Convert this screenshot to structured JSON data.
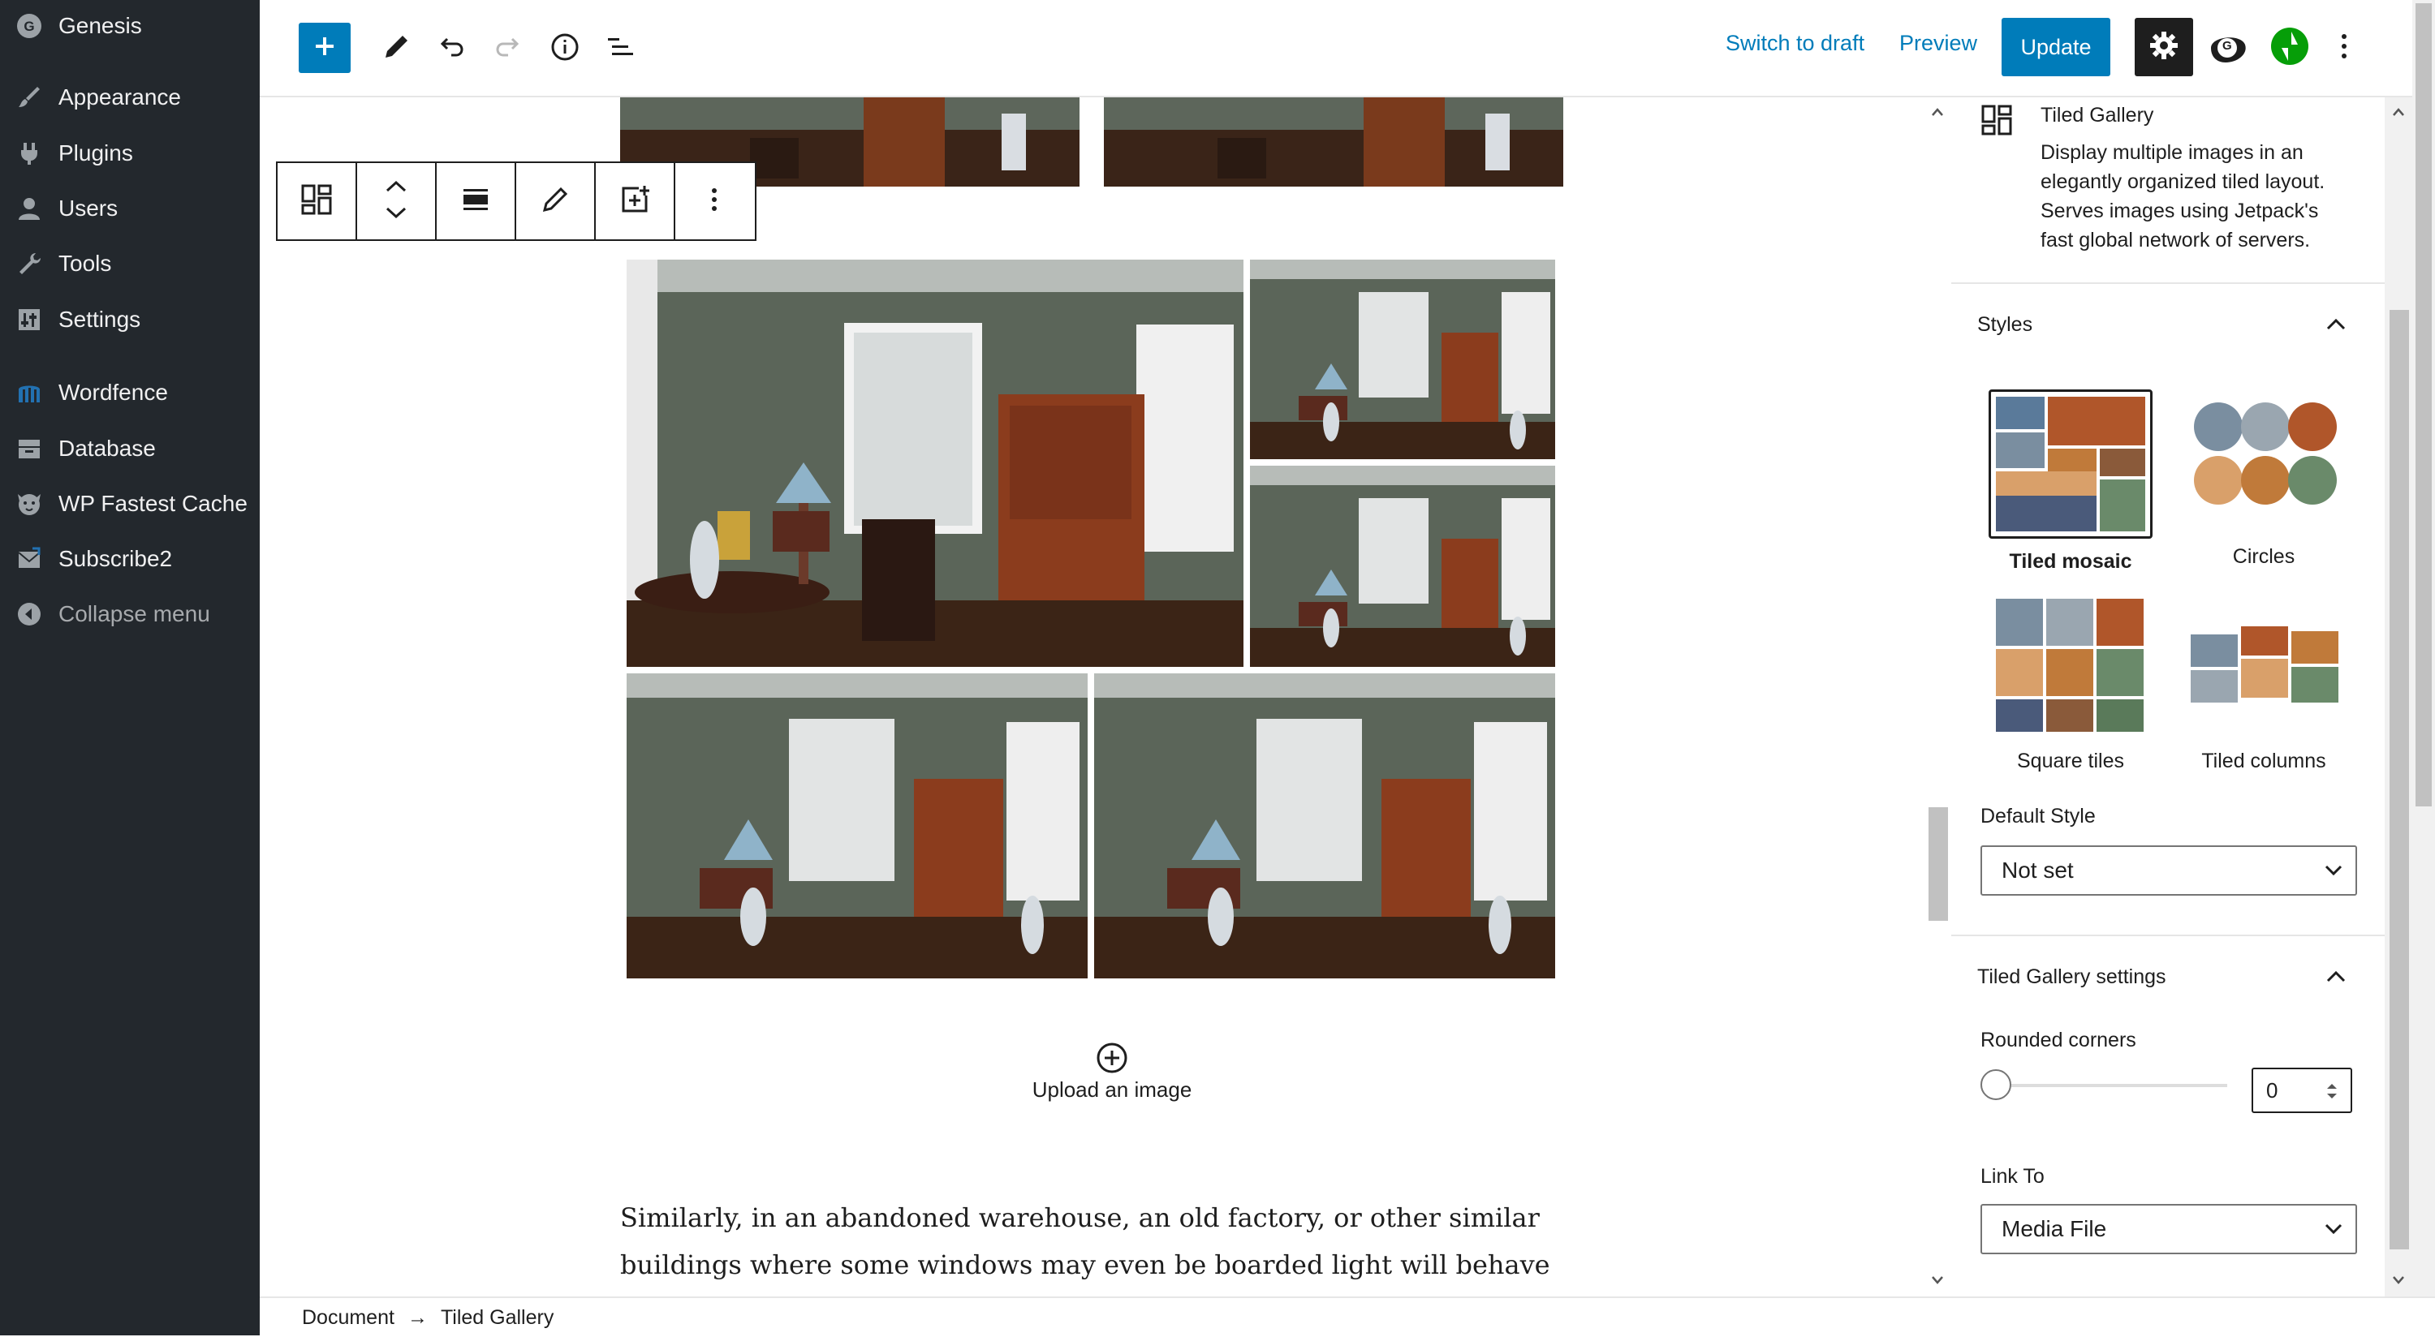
{
  "admin_menu": {
    "items": [
      {
        "label": "Genesis",
        "icon": "genesis-icon"
      },
      {
        "label": "Appearance",
        "icon": "paintbrush-icon"
      },
      {
        "label": "Plugins",
        "icon": "plug-icon"
      },
      {
        "label": "Users",
        "icon": "user-icon"
      },
      {
        "label": "Tools",
        "icon": "wrench-icon"
      },
      {
        "label": "Settings",
        "icon": "settings-icon"
      },
      {
        "label": "Wordfence",
        "icon": "wordfence-icon"
      },
      {
        "label": "Database",
        "icon": "database-icon"
      },
      {
        "label": "WP Fastest Cache",
        "icon": "cheetah-icon"
      },
      {
        "label": "Subscribe2",
        "icon": "mail-icon"
      },
      {
        "label": "Collapse menu",
        "icon": "collapse-icon"
      }
    ]
  },
  "topbar": {
    "switch_to_draft": "Switch to draft",
    "preview": "Preview",
    "update": "Update",
    "avatar_letter": "G"
  },
  "editor": {
    "upload_label": "Upload an image",
    "paragraph_line1": "Similarly, in an abandoned warehouse, an old factory, or other similar",
    "paragraph_line2": "buildings where some windows may even be boarded light will behave the"
  },
  "sidebar": {
    "block_title": "Tiled Gallery",
    "block_description_lines": [
      "Display multiple images in an",
      "elegantly organized tiled layout.",
      "Serves images using Jetpack's",
      "fast global network of servers."
    ],
    "styles_heading": "Styles",
    "styles": [
      {
        "label": "Tiled mosaic",
        "selected": true
      },
      {
        "label": "Circles",
        "selected": false
      },
      {
        "label": "Square tiles",
        "selected": false
      },
      {
        "label": "Tiled columns",
        "selected": false
      }
    ],
    "default_style_label": "Default Style",
    "default_style_value": "Not set",
    "settings_heading": "Tiled Gallery settings",
    "rounded_corners_label": "Rounded corners",
    "rounded_corners_value": "0",
    "link_to_label": "Link To",
    "link_to_value": "Media File"
  },
  "breadcrumb": {
    "root": "Document",
    "arrow": "→",
    "current": "Tiled Gallery"
  },
  "colors": {
    "admin_bg": "#23282d",
    "accent": "#007cba",
    "jetpack_green": "#069e08"
  }
}
